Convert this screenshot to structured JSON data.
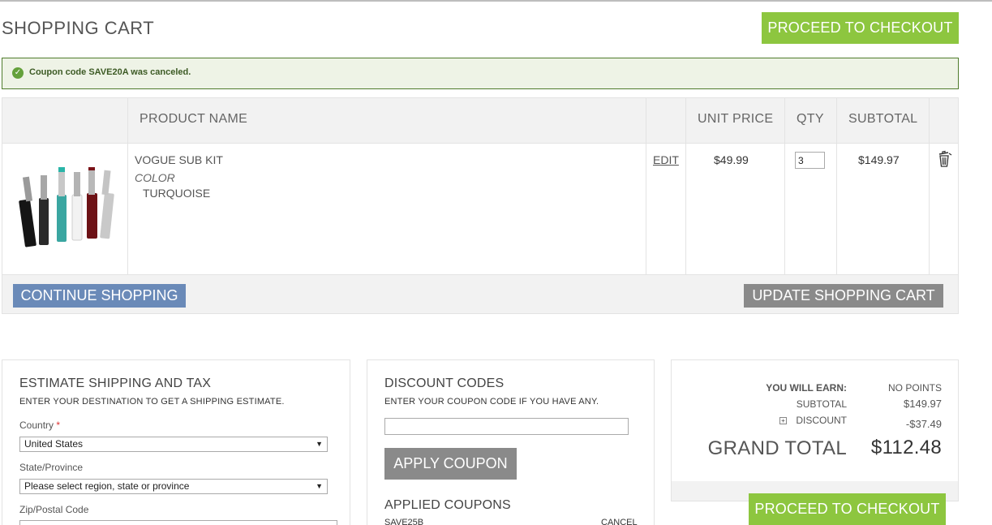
{
  "page": {
    "title": "SHOPPING CART"
  },
  "actions": {
    "checkout_top": "PROCEED TO CHECKOUT",
    "checkout_bottom": "PROCEED TO CHECKOUT",
    "continue_shopping": "CONTINUE SHOPPING",
    "update_cart": "UPDATE SHOPPING CART",
    "apply_coupon": "APPLY COUPON"
  },
  "message": {
    "text": "Coupon code SAVE20A was canceled.",
    "type": "success"
  },
  "cart": {
    "columns": [
      "PRODUCT NAME",
      "UNIT PRICE",
      "QTY",
      "SUBTOTAL"
    ],
    "items": [
      {
        "name": "VOGUE SUB KIT",
        "option_label": "COLOR",
        "option_value": "TURQUOISE",
        "edit_label": "EDIT",
        "unit_price": "$49.99",
        "qty": "3",
        "subtotal": "$149.97",
        "image": "vape-kit-product-image",
        "remove_icon": "trash-icon"
      }
    ]
  },
  "shipping": {
    "title": "ESTIMATE SHIPPING AND TAX",
    "subtitle": "ENTER YOUR DESTINATION TO GET A SHIPPING ESTIMATE.",
    "country_label": "Country",
    "required_mark": "*",
    "country_value": "United States",
    "state_label": "State/Province",
    "state_value": "Please select region, state or province",
    "zip_label": "Zip/Postal Code"
  },
  "discount": {
    "title": "DISCOUNT CODES",
    "subtitle": "ENTER YOUR COUPON CODE IF YOU HAVE ANY.",
    "input_value": "",
    "applied_title": "APPLIED COUPONS",
    "applied": [
      {
        "code": "SAVE25B",
        "cancel_label": "CANCEL"
      }
    ]
  },
  "totals": {
    "earn_label": "YOU WILL EARN:",
    "earn_value": "NO POINTS",
    "subtotal_label": "SUBTOTAL",
    "subtotal_value": "$149.97",
    "discount_label": "DISCOUNT",
    "discount_value": "-$37.49",
    "grand_label": "GRAND TOTAL",
    "grand_value": "$112.48"
  },
  "colors": {
    "accent_green": "#8dc63f",
    "continue_blue": "#6a8ab8",
    "neutral_button": "#8a8a8a",
    "message_border": "#4f7c2c"
  }
}
